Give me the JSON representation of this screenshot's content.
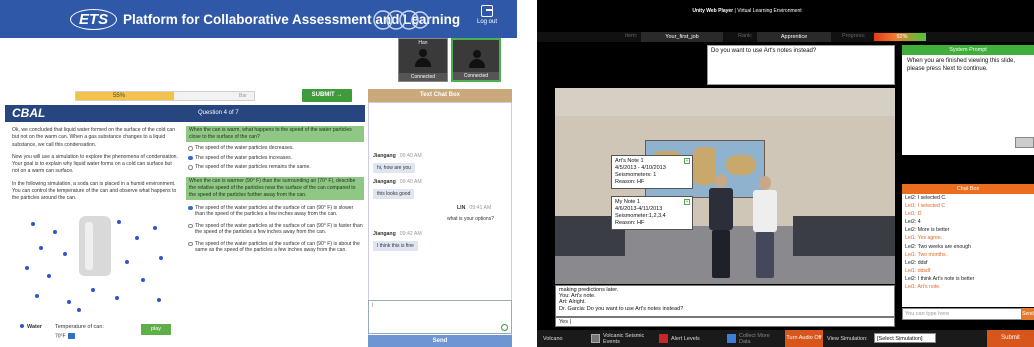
{
  "left": {
    "header": {
      "logo": "ETS",
      "title": "Platform for Collaborative Assessment and Learning",
      "logout": "Log out"
    },
    "video_tiles": [
      {
        "name": "Han",
        "status": "Connected"
      },
      {
        "name": "",
        "status": "Connected"
      }
    ],
    "progress": {
      "label": "55%",
      "value": 0.55,
      "tag": "Bar"
    },
    "submit_label": "SUBMIT →",
    "chat_title": "Text Chat Box",
    "cbal": {
      "logo": "CBAL",
      "question": "Question 4 of 7"
    },
    "passage": [
      "Ok, we concluded that liquid water formed on the surface of the cold can but not on the warm can. When a gas substance changes to a liquid substance, we call this condensation.",
      "Now you will use a simulation to explore the phenomena of condensation. Your goal is to explain why liquid water forms on a cold can surface but not on a warm can surface.",
      "In the following simulation, a soda can is placed in a humid environment. You can control the temperature of the can and observe what happens to the particles around the can."
    ],
    "simulation": {
      "legend": "Water",
      "temp_label": "Temperature of can:",
      "temp_value": "70°F",
      "play": "play"
    },
    "question1": {
      "stem": "When the can is warm, what happens to the speed of the water particles close to the surface of the can?",
      "options": [
        {
          "text": "The speed of the water particles decreases.",
          "selected": false
        },
        {
          "text": "The speed of the water particles increases.",
          "selected": true
        },
        {
          "text": "The speed of the water particles remains the same.",
          "selected": false
        }
      ]
    },
    "question2": {
      "stem": "When the can is warmer (90° F) than the surrounding air (70° F), describe the relative speed of the particles near the surface of the can compared to the speed of the particles further away from the can.",
      "options": [
        {
          "text": "The speed of the water particles at the surface of can (90° F) is slower than the speed of the particles a few inches away from the can.",
          "selected": true
        },
        {
          "text": "The speed of the water particles at the surface of can (90° F) is faster than the speed of the particles a few inches away from the can.",
          "selected": false
        },
        {
          "text": "The speed of the water particles at the surface of can (90° F) is about the same as the speed of the particles a few inches away from the can.",
          "selected": false
        }
      ]
    },
    "chat": [
      {
        "name": "Jiangang",
        "time": "09:40 AM",
        "text": "hi, how are you"
      },
      {
        "name": "Jiangang",
        "time": "09:40 AM",
        "text": "this looks good"
      },
      {
        "name": "LIN",
        "time": "09:41 AM",
        "text": "what is your options?"
      },
      {
        "name": "Jiangang",
        "time": "09:42 AM",
        "text": "I think this is fine"
      }
    ],
    "chat_input": "l",
    "send_label": "Send"
  },
  "right": {
    "title_bold": "Unity Web Player",
    "title_rest": " | Virtual Learning Environment",
    "stats": {
      "item_label": "Item:",
      "item_value": "Your_first_job",
      "rank_label": "Rank:",
      "rank_value": "Apprentice",
      "progress_label": "Progress:",
      "progress_value": "92%",
      "progress": 0.92
    },
    "prompt_question": "Do you want to use Art's notes instead?",
    "system_prompt": {
      "title": "System Prompt",
      "body": "When you are finished viewing this slide, please press Next to continue."
    },
    "notes": [
      {
        "lines": [
          "Art's Note 1",
          "4/5/2013 - 4/10/2013",
          "Seismometers: 1",
          "Reason: HF"
        ]
      },
      {
        "lines": [
          "My Note 1",
          "4/6/2013-4/11/2013",
          "Seismometer:1,2,3,4",
          "Reason: HF"
        ]
      }
    ],
    "dialog": [
      "making predictions later.",
      "You: Art's note.",
      "Art: Alright.",
      "Dr. Garcia: Do you want to use Art's notes instead?"
    ],
    "dialog_input": "Yes |",
    "chat_title": "Chat Box",
    "chat_lines": [
      {
        "text": "Lei2: I selected C.",
        "orange": false
      },
      {
        "text": "Lei1: I selected C",
        "orange": true
      },
      {
        "text": "Lei1: D",
        "orange": true
      },
      {
        "text": "Lei2: 4",
        "orange": false
      },
      {
        "text": "Lei2: More is better",
        "orange": false
      },
      {
        "text": "Lei1: Yes agree.",
        "orange": true
      },
      {
        "text": "Lei2: Two weeks are enough",
        "orange": false
      },
      {
        "text": "Lei1: Two months.",
        "orange": true
      },
      {
        "text": "Lei2: ddsf",
        "orange": false
      },
      {
        "text": "Lei1: ddsdf",
        "orange": true
      },
      {
        "text": "Lei2: I think Art's note is better",
        "orange": false
      },
      {
        "text": "Lei1: Art's note.",
        "orange": true
      }
    ],
    "chat_placeholder": "You can type here",
    "chat_send": "Send",
    "toolbar": {
      "volcano": "Volcano",
      "volcanic": "Volcanic Seismic Events",
      "alert": "Alert Levels",
      "collect": "Collect More Data",
      "audio": "Turn Audio Off",
      "view_sim": "View Simulation:",
      "select_sim": "[Select Simulation]",
      "submit": "Submit"
    }
  }
}
